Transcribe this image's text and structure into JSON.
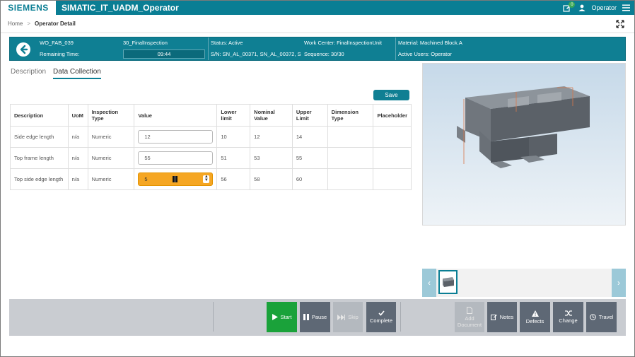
{
  "app": {
    "brand": "SIEMENS",
    "title": "SIMATIC_IT_UADM_Operator",
    "notification_count": "0",
    "user": "Operator"
  },
  "breadcrumb": {
    "home": "Home",
    "separator": ">",
    "current": "Operator Detail"
  },
  "header": {
    "work_order": "WO_FAB_039",
    "operation": "30_FinalInspection",
    "remaining_label": "Remaining Time:",
    "remaining_time": "09:44",
    "status": "Status: Active",
    "serials": "S/N: SN_AL_00371, SN_AL_00372, SN",
    "work_center": "Work Center: FinalInspectionUnit",
    "sequence": "Sequence: 30/30",
    "material": "Material: Machined Block.A",
    "active_users": "Active Users: Operator"
  },
  "tabs": [
    {
      "label": "Description",
      "active": false
    },
    {
      "label": "Data Collection",
      "active": true
    }
  ],
  "save_label": "Save",
  "table": {
    "columns": [
      "Description",
      "UoM",
      "Inspection Type",
      "Value",
      "Lower limit",
      "Nominal Value",
      "Upper Limit",
      "Dimension Type",
      "Placeholder"
    ],
    "rows": [
      {
        "description": "Side edge length",
        "uom": "n/a",
        "type": "Numeric",
        "value": "12",
        "lower": "10",
        "nominal": "12",
        "upper": "14",
        "dimension": "",
        "placeholder": ""
      },
      {
        "description": "Top frame length",
        "uom": "n/a",
        "type": "Numeric",
        "value": "55",
        "lower": "51",
        "nominal": "53",
        "upper": "55",
        "dimension": "",
        "placeholder": ""
      },
      {
        "description": "Top side edge length",
        "uom": "n/a",
        "type": "Numeric",
        "value": "5",
        "lower": "56",
        "nominal": "58",
        "upper": "60",
        "dimension": "",
        "placeholder": ""
      }
    ]
  },
  "toolbar": {
    "start": "Start",
    "pause": "Pause",
    "skip": "Skip",
    "complete": "Complete",
    "add_document": "Add Document",
    "notes": "Notes",
    "defects": "Defects",
    "change": "Change",
    "travel": "Travel"
  },
  "colors": {
    "brand": "#0a7e94",
    "start": "#1aa23a",
    "active_input": "#f5a623",
    "toolbar_button": "#5e6875"
  }
}
